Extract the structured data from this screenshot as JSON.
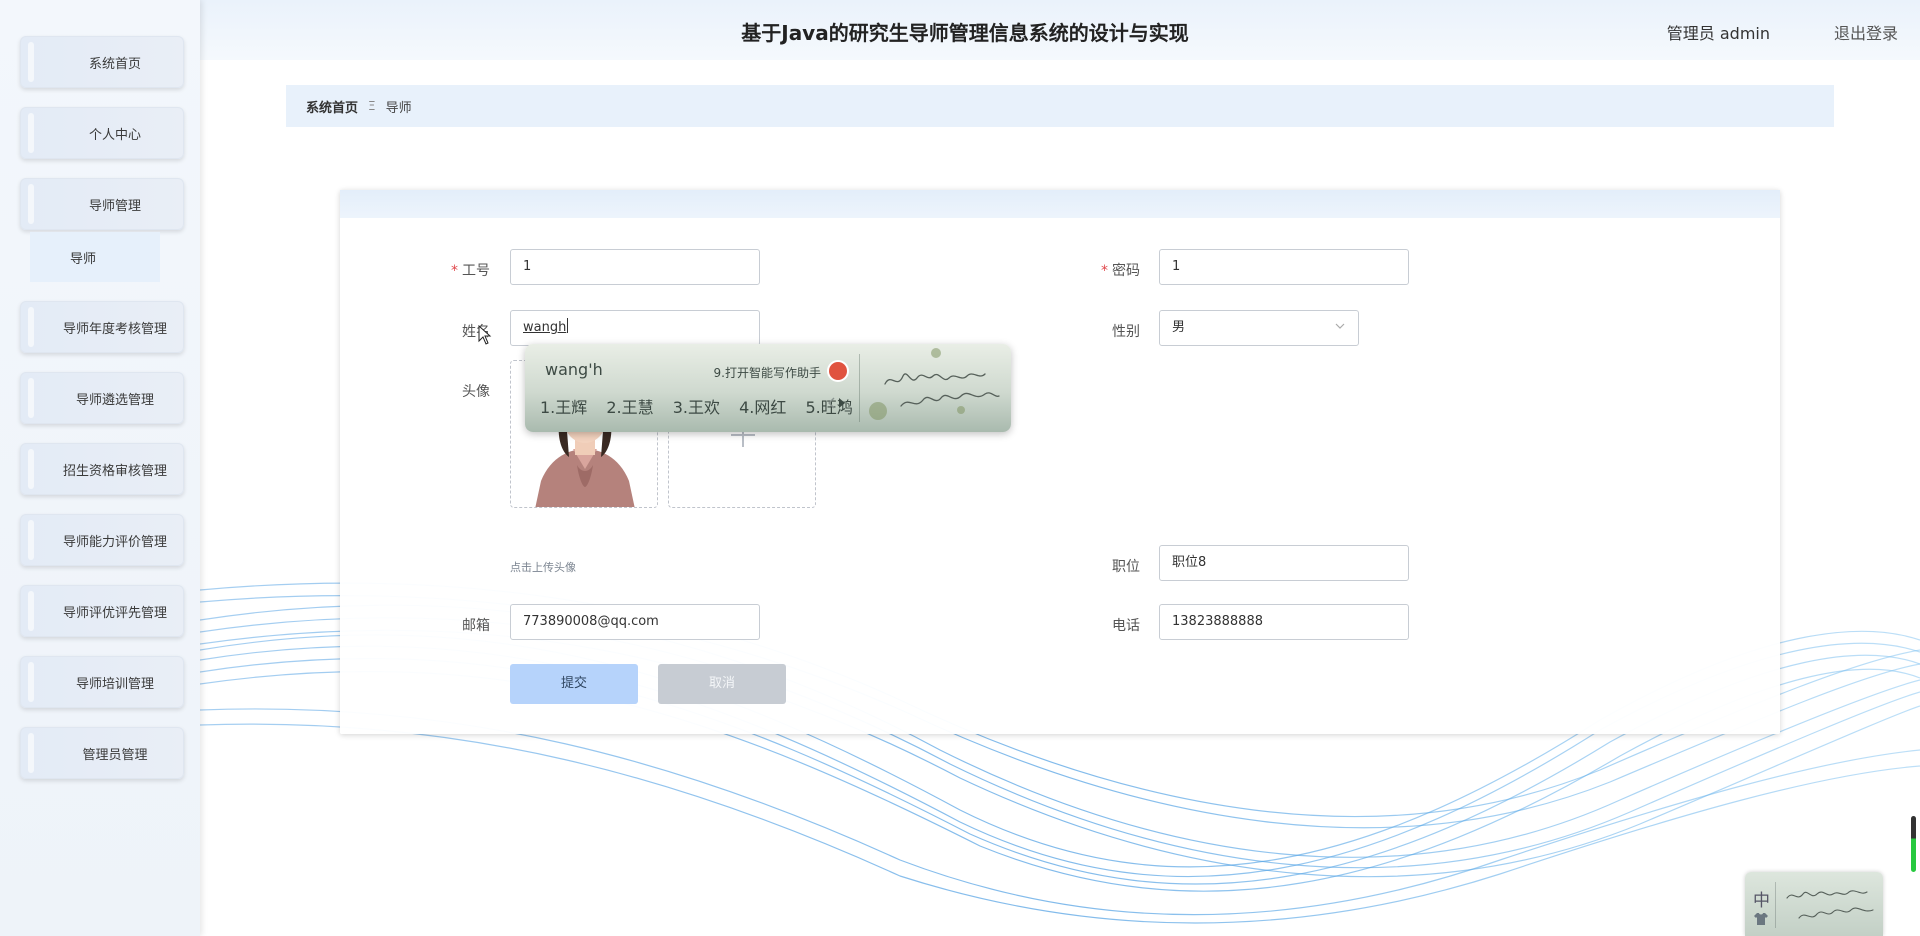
{
  "header": {
    "title": "基于Java的研究生导师管理信息系统的设计与实现",
    "user": "管理员 admin",
    "logout": "退出登录"
  },
  "sidebar": {
    "items": [
      {
        "label": "系统首页"
      },
      {
        "label": "个人中心"
      },
      {
        "label": "导师管理"
      },
      {
        "label": "导师年度考核管理"
      },
      {
        "label": "导师遴选管理"
      },
      {
        "label": "招生资格审核管理"
      },
      {
        "label": "导师能力评价管理"
      },
      {
        "label": "导师评优评先管理"
      },
      {
        "label": "导师培训管理"
      },
      {
        "label": "管理员管理"
      }
    ],
    "submenu": {
      "label": "导师"
    }
  },
  "breadcrumb": {
    "home": "系统首页",
    "separator": "Ξ",
    "current": "导师"
  },
  "form": {
    "job_no": {
      "label": "工号",
      "value": "1"
    },
    "password": {
      "label": "密码",
      "value": "1"
    },
    "name": {
      "label": "姓名",
      "value": "wangh"
    },
    "gender": {
      "label": "性别",
      "value": "男"
    },
    "avatar": {
      "label": "头像",
      "hint": "点击上传头像"
    },
    "position": {
      "label": "职位",
      "value": "职位8"
    },
    "email": {
      "label": "邮箱",
      "value": "773890008@qq.com"
    },
    "phone": {
      "label": "电话",
      "value": "13823888888"
    },
    "submit_label": "提交",
    "cancel_label": "取消",
    "required_mark": "*"
  },
  "ime": {
    "pinyin": "wang'h",
    "assist": "9.打开智能写作助手",
    "candidates": [
      "1.王辉",
      "2.王慧",
      "3.王欢",
      "4.网红",
      "5.旺鸿"
    ],
    "mode": "中"
  },
  "colors": {
    "accent": "#b6d3fb",
    "required": "#e0474b",
    "breadcrumb_bg": "#e8f1fb"
  }
}
